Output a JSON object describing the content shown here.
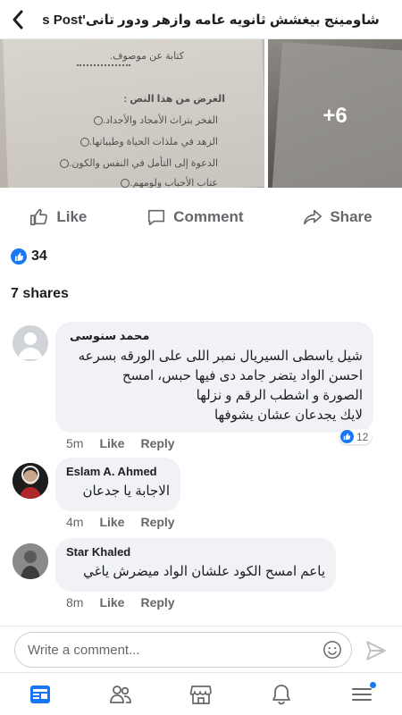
{
  "header": {
    "title": "شاومينج بيغشش ثانويه عامه وازهر ودور تانى's Post"
  },
  "photos": {
    "more_count": "+6",
    "paper_lines": [
      "كتابة عن موصوف.",
      "الغرض من هذا النص :",
      "الفخر بتراث الأمجاد والأجداد.",
      "الزهد في ملذات الحياة وطيباتها.",
      "الدعوة إلى التأمل في النفس والكون.",
      "عتاب الأحباب ولومهم."
    ]
  },
  "actions": {
    "like": "Like",
    "comment": "Comment",
    "share": "Share"
  },
  "reactions": {
    "count": "34"
  },
  "shares": "7 shares",
  "comments": [
    {
      "author": "محمد سنوسى",
      "lines": [
        "شيل ياسطى السيريال نمبر اللى على الورقه بسرعه",
        "احسن الواد يتضر جامد دى فيها حبس، امسح",
        "الصورة و اشطب الرقم و نزلها",
        "لايك يجدعان عشان يشوفها"
      ],
      "time": "5m",
      "like": "Like",
      "reply": "Reply",
      "reactions": "12"
    },
    {
      "author": "Eslam A. Ahmed",
      "lines": [
        "الاجابة يا جدعان"
      ],
      "time": "4m",
      "like": "Like",
      "reply": "Reply"
    },
    {
      "author": "Star Khaled",
      "lines": [
        "ياعم امسح الكود علشان الواد ميضرش ياغي"
      ],
      "time": "8m",
      "like": "Like",
      "reply": "Reply"
    }
  ],
  "composer": {
    "placeholder": "Write a comment..."
  },
  "colors": {
    "accent": "#1877f2",
    "secondary_text": "#65676b",
    "bubble": "#f0f2f5"
  },
  "icons": [
    "back-icon",
    "like-icon",
    "comment-icon",
    "share-icon",
    "emoji-icon",
    "send-icon",
    "feed-icon",
    "friends-icon",
    "marketplace-icon",
    "notifications-icon",
    "menu-icon"
  ]
}
